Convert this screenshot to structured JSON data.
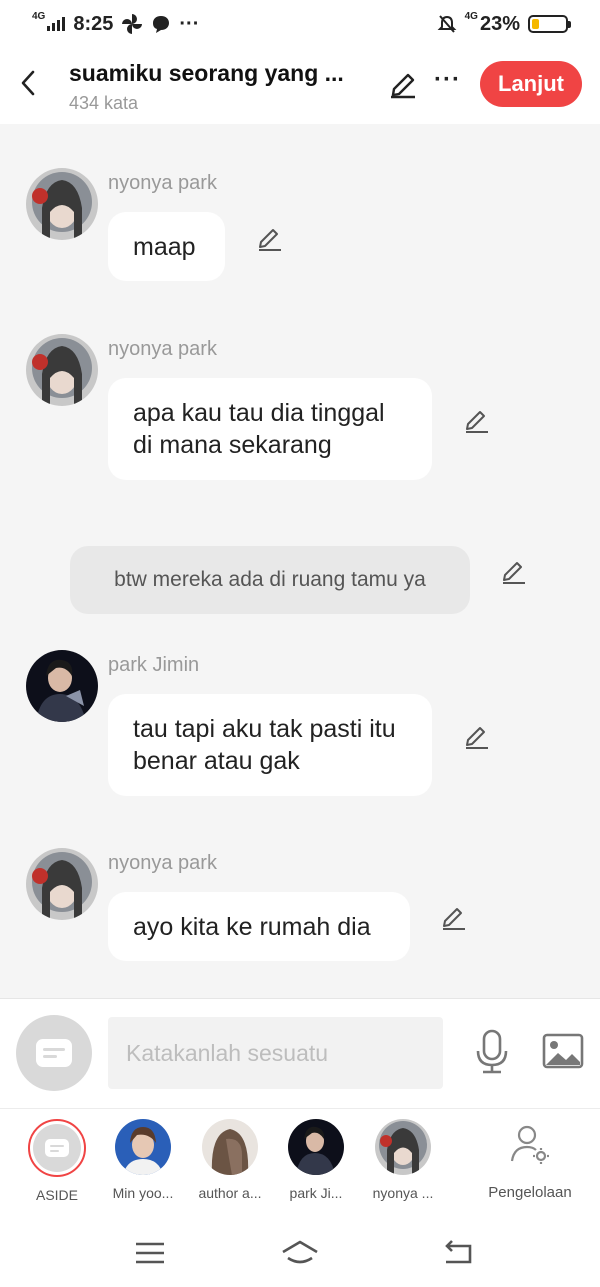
{
  "status": {
    "network_left": "4G",
    "time": "8:25",
    "more_dots": "···",
    "network_right": "4G",
    "battery_percent": "23%",
    "battery_level": 0.23,
    "battery_color": "#f5b800"
  },
  "header": {
    "title": "suamiku seorang yang ...",
    "subtitle": "434 kata",
    "more": "···",
    "next_label": "Lanjut",
    "accent": "#f04444"
  },
  "messages": [
    {
      "type": "bubble",
      "sender": "nyonya park",
      "text": "maap",
      "avatar": "nyonya-park"
    },
    {
      "type": "bubble",
      "sender": "nyonya park",
      "text": "apa kau tau dia tinggal di mana sekarang",
      "avatar": "nyonya-park"
    },
    {
      "type": "narration",
      "text": "btw mereka ada di ruang tamu ya"
    },
    {
      "type": "bubble",
      "sender": "park Jimin",
      "text": "tau tapi aku tak pasti itu benar atau gak",
      "avatar": "park-jimin"
    },
    {
      "type": "bubble",
      "sender": "nyonya park",
      "text": "ayo kita ke rumah dia",
      "avatar": "nyonya-park"
    }
  ],
  "composer": {
    "placeholder": "Katakanlah sesuatu",
    "value": ""
  },
  "characters": [
    {
      "label": "ASIDE",
      "icon": "aside-icon"
    },
    {
      "label": "Min yoo..."
    },
    {
      "label": "author a..."
    },
    {
      "label": "park Ji..."
    },
    {
      "label": "nyonya ..."
    }
  ],
  "manage": {
    "label": "Pengelolaan",
    "icon": "user-settings-icon"
  },
  "navbar": {
    "icons": [
      "menu-icon",
      "home-icon",
      "back-icon"
    ]
  }
}
